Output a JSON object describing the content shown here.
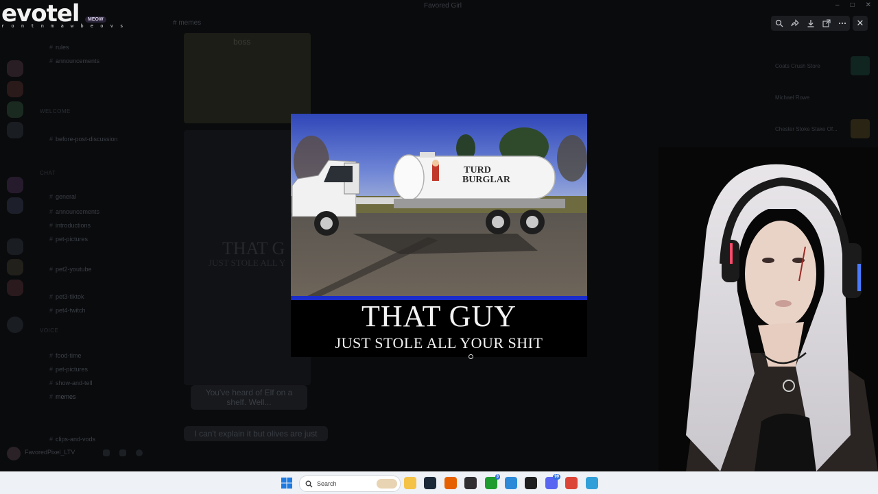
{
  "overlay": {
    "logo_text": "evotel",
    "logo_subtext": "r o n t  n m a w b e  o v s",
    "meow_badge": "MEOW"
  },
  "background_app": {
    "window_title": "Favored Girl",
    "channel_header": "memes",
    "categories": [
      "Welcome",
      "Chat",
      "Voice"
    ],
    "channels": [
      "rules",
      "announcements",
      "before-post-discussion",
      "general",
      "announcements",
      "introductions",
      "pet-pictures",
      "pet2-youtube",
      "pet3-tiktok",
      "pet4-twitch",
      "food-time",
      "pet-pictures",
      "show-and-tell",
      "memes",
      "clips-and-vods"
    ],
    "thumb_caption": "boss",
    "thumb_meme_text": "THAT G",
    "thumb_meme_sub": "JUST STOLE ALL Y",
    "bubble_one": "You've heard of Elf on a shelf. Well...",
    "bubble_two": "I can't explain it but olives are just",
    "user_name": "FavoredPixel_LTV",
    "right_panel_items": [
      "Coats Crush Store",
      "Michael Rowe",
      "Chester Stoke Stake Of..."
    ]
  },
  "viewer": {
    "toolbar_icons": [
      "zoom-icon",
      "share-icon",
      "download-icon",
      "open-external-icon",
      "more-icon"
    ],
    "close_label": "✕"
  },
  "meme": {
    "truck_logo_line1": "TURD",
    "truck_logo_line2": "BURGLAR",
    "title": "THAT GUY",
    "subtitle": "JUST STOLE ALL YOUR SHIT"
  },
  "taskbar": {
    "search_placeholder": "Search",
    "apps": [
      {
        "name": "file-explorer-icon",
        "color": "#f4c247",
        "badge": ""
      },
      {
        "name": "steam-icon",
        "color": "#1b2838",
        "badge": ""
      },
      {
        "name": "firefox-icon",
        "color": "#e66000",
        "badge": ""
      },
      {
        "name": "obs-icon",
        "color": "#302e31",
        "badge": ""
      },
      {
        "name": "xbox-icon",
        "color": "#1e9c2f",
        "badge": "3"
      },
      {
        "name": "app-blue-icon",
        "color": "#2c8ad8",
        "badge": ""
      },
      {
        "name": "terminal-icon",
        "color": "#1f1f1f",
        "badge": ""
      },
      {
        "name": "discord-icon",
        "color": "#5865f2",
        "badge": "99"
      },
      {
        "name": "chrome-icon",
        "color": "#db4437",
        "badge": ""
      },
      {
        "name": "notepad-icon",
        "color": "#32a0d8",
        "badge": ""
      }
    ]
  }
}
